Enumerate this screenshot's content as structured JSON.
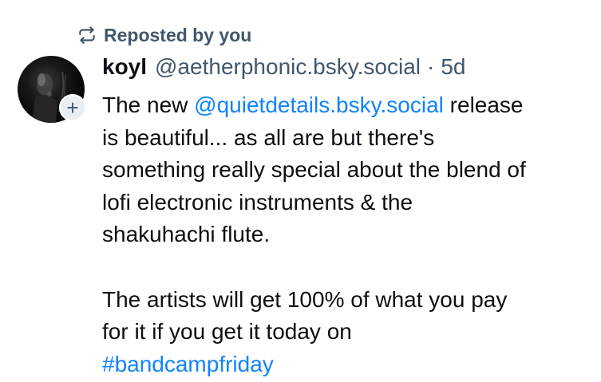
{
  "repost": {
    "label": "Reposted by you",
    "icon": "repost-icon"
  },
  "post": {
    "author_name": "koyl",
    "author_handle": "@aetherphonic.bsky.social",
    "separator": "·",
    "time_ago": "5d",
    "follow_symbol": "+",
    "paragraph1": {
      "before_mention": "The new ",
      "mention": "@quietdetails.bsky.social",
      "line1_after_mention": " release",
      "line2": "is beautiful... as all are but there's",
      "line3": "something really special about the blend of",
      "line4": "lofi electronic instruments & the",
      "line5": "shakuhachi flute."
    },
    "paragraph2": {
      "line1": "The artists will get 100% of what you pay",
      "line2": "for it if you get it today on",
      "hashtag": "#bandcampfriday"
    }
  },
  "colors": {
    "text": "#0b0f14",
    "muted": "#42576c",
    "link": "#1083fe",
    "badge_bg": "#e9eef3"
  }
}
